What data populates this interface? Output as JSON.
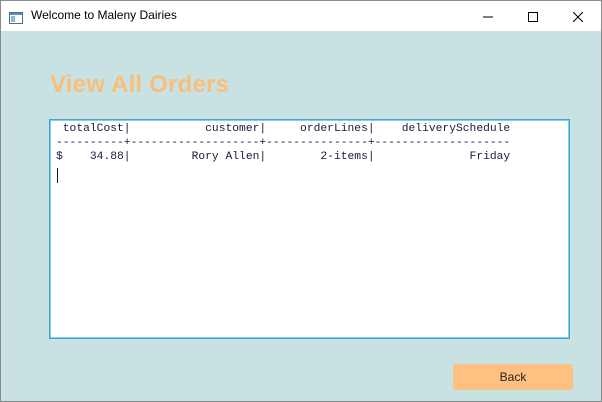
{
  "window": {
    "title": "Welcome to Maleny Dairies"
  },
  "page": {
    "heading": "View All Orders",
    "orders_text": " totalCost|           customer|     orderLines|    deliverySchedule\n----------+-------------------+---------------+--------------------\n$    34.88|         Rory Allen|        2-items|              Friday",
    "back_label": "Back"
  },
  "colors": {
    "background": "#c8e1e3",
    "heading": "#f9bf7a",
    "button": "#ffc181",
    "focus_border": "#3aa7d6"
  },
  "icons": {
    "app": "window-app-icon",
    "minimize": "minimize-icon",
    "maximize": "maximize-icon",
    "close": "close-icon"
  }
}
